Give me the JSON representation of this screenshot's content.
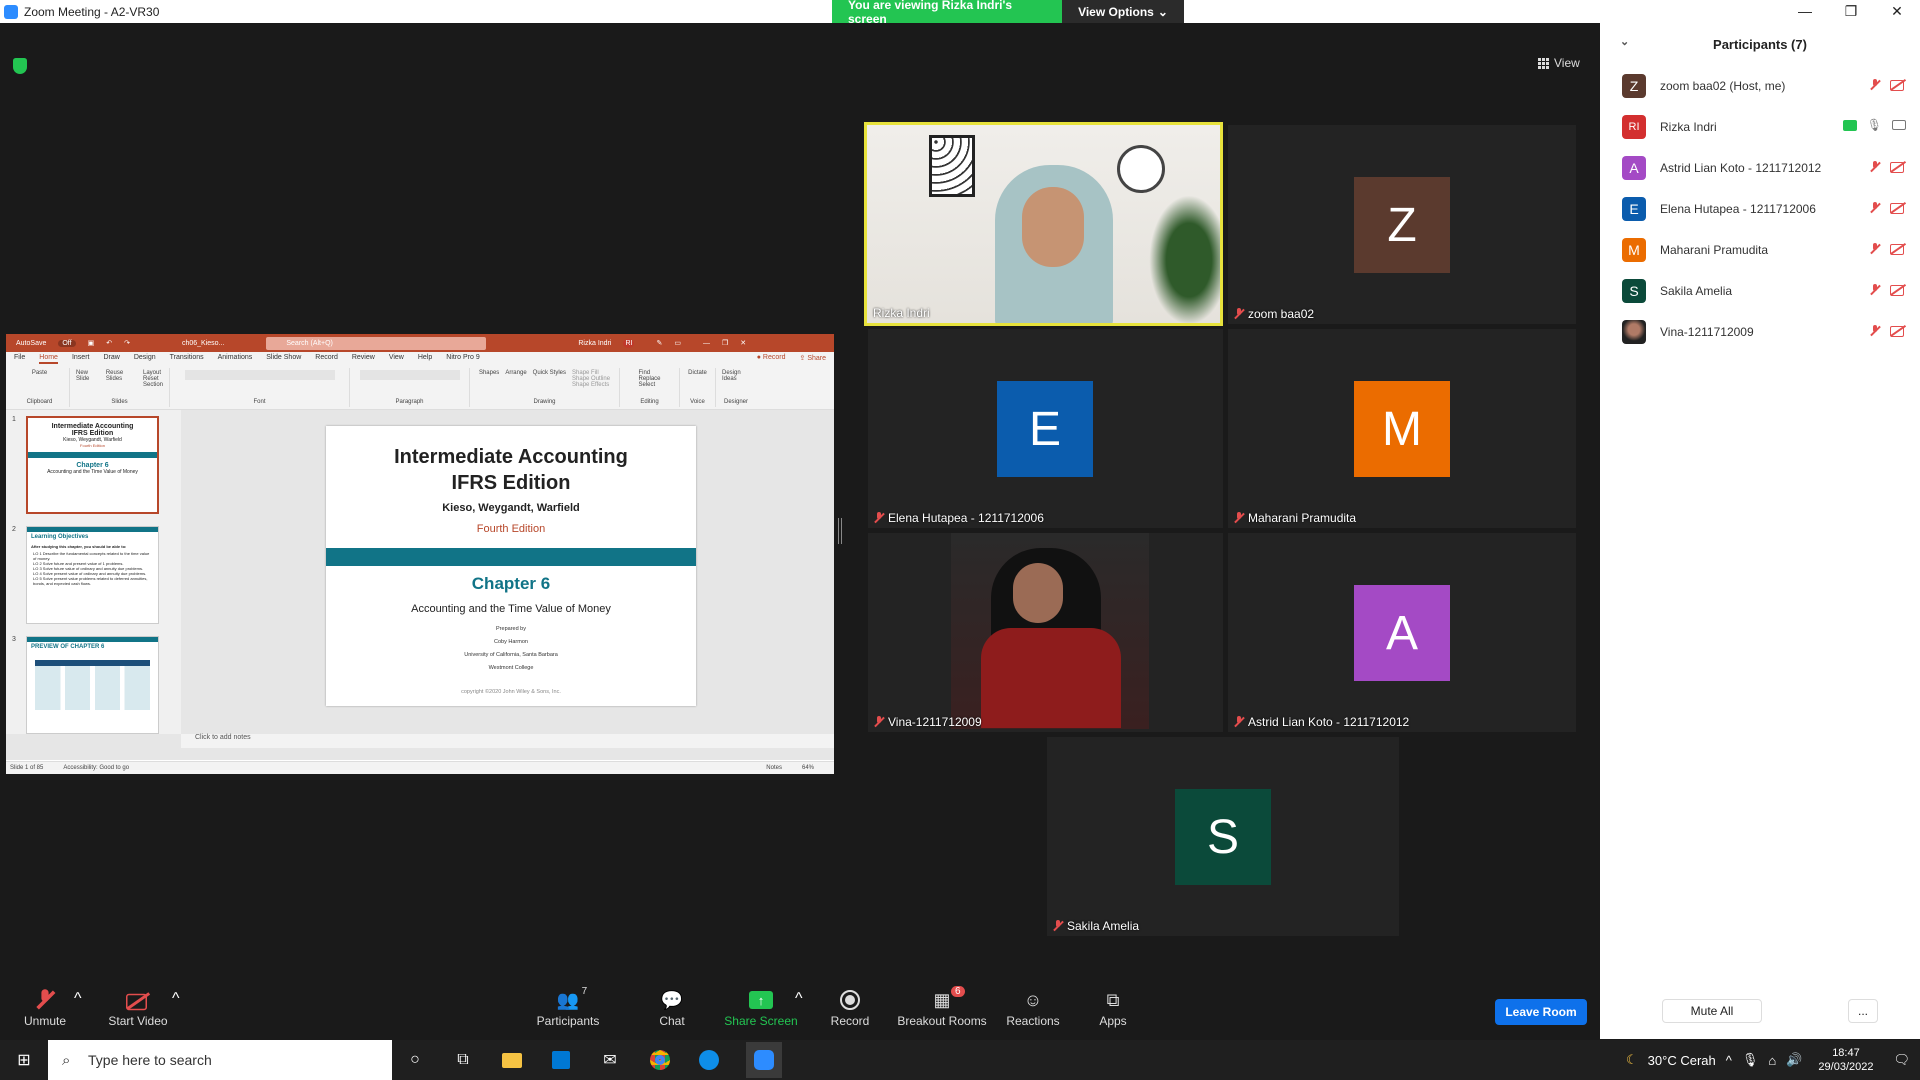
{
  "window": {
    "title": "Zoom Meeting - A2-VR30"
  },
  "share_bar": {
    "viewing": "You are viewing Rizka Indri's screen",
    "options": "View Options"
  },
  "view_button": {
    "label": "View"
  },
  "ppt": {
    "autosave": "AutoSave",
    "autosave_state": "Off",
    "filename": "ch06_Kieso...",
    "search": "Search (Alt+Q)",
    "user": "Rizka Indri",
    "user_initials": "RI",
    "tabs": [
      "File",
      "Home",
      "Insert",
      "Draw",
      "Design",
      "Transitions",
      "Animations",
      "Slide Show",
      "Record",
      "Review",
      "View",
      "Help",
      "Nitro Pro 9"
    ],
    "record": "Record",
    "share": "Share",
    "ribbon_groups": [
      "Clipboard",
      "Slides",
      "Font",
      "Paragraph",
      "Drawing",
      "Editing",
      "Voice",
      "Designer"
    ],
    "ribbon_items": {
      "paste": "Paste",
      "new_slide": "New Slide",
      "reuse": "Reuse Slides",
      "layout": "Layout",
      "reset": "Reset",
      "section": "Section",
      "shapes": "Shapes",
      "arrange": "Arrange",
      "quick": "Quick Styles",
      "shape_fill": "Shape Fill",
      "shape_outline": "Shape Outline",
      "shape_effects": "Shape Effects",
      "find": "Find",
      "replace": "Replace",
      "select": "Select",
      "dictate": "Dictate",
      "design_ideas": "Design Ideas"
    },
    "slide": {
      "title1": "Intermediate Accounting",
      "title2": "IFRS Edition",
      "authors": "Kieso, Weygandt, Warfield",
      "edition": "Fourth Edition",
      "chapter": "Chapter 6",
      "subtitle": "Accounting and the Time Value of Money",
      "prepared": "Prepared by",
      "preparer": "Coby Harmon",
      "univ": "University of California, Santa Barbara",
      "college": "Westmont College",
      "copyright": "copyright ©2020 John Wiley & Sons, Inc."
    },
    "thumbs": [
      {
        "num": "1",
        "title": "Intermediate Accounting",
        "title2": "IFRS Edition",
        "authors": "Kieso, Weygandt, Warfield",
        "edition": "Fourth Edition",
        "chapter": "Chapter 6",
        "subtitle": "Accounting and the Time Value of Money"
      },
      {
        "num": "2",
        "title": "Learning Objectives",
        "intro": "After studying this chapter, you should be able to:",
        "items": [
          "LO 1 Describe the fundamental concepts related to the time value of money.",
          "LO 2 Solve future and present value of 1 problems.",
          "LO 3 Solve future value of ordinary and annuity due problems.",
          "LO 4 Solve present value of ordinary and annuity due problems.",
          "LO 5 Solve present value problems related to deferred annuities, bonds, and expected cash flows."
        ]
      },
      {
        "num": "3",
        "title": "PREVIEW OF CHAPTER 6"
      }
    ],
    "notes": "Click to add notes",
    "status_slide": "Slide 1 of 85",
    "accessibility": "Accessibility: Good to go",
    "notes_btn": "Notes",
    "zoom": "64%"
  },
  "video_tiles": [
    {
      "name": "Rizka Indri",
      "type": "camera",
      "muted": false
    },
    {
      "name": "zoom baa02",
      "type": "avatar",
      "initial": "Z",
      "color": "#5b3a2e",
      "muted": true
    },
    {
      "name": "Elena Hutapea - 1211712006",
      "type": "avatar",
      "initial": "E",
      "color": "#0b5cad",
      "muted": true
    },
    {
      "name": "Maharani Pramudita",
      "type": "avatar",
      "initial": "M",
      "color": "#eb6c00",
      "muted": true
    },
    {
      "name": "Vina-1211712009",
      "type": "camera",
      "muted": true
    },
    {
      "name": "Astrid Lian Koto - 1211712012",
      "type": "avatar",
      "initial": "A",
      "color": "#a44ac5",
      "muted": true
    },
    {
      "name": "Sakila Amelia",
      "type": "avatar",
      "initial": "S",
      "color": "#0b4a3a",
      "muted": true
    }
  ],
  "participants": {
    "title": "Participants (7)",
    "list": [
      {
        "name": "zoom baa02 (Host, me)",
        "initial": "Z",
        "color": "#5b3a2e"
      },
      {
        "name": "Rizka Indri",
        "initial": "RI",
        "color": "#d32f2f"
      },
      {
        "name": "Astrid Lian Koto - 1211712012",
        "initial": "A",
        "color": "#a44ac5"
      },
      {
        "name": "Elena Hutapea - 1211712006",
        "initial": "E",
        "color": "#0b5cad"
      },
      {
        "name": "Maharani Pramudita",
        "initial": "M",
        "color": "#eb6c00"
      },
      {
        "name": "Sakila Amelia",
        "initial": "S",
        "color": "#0b4a3a"
      },
      {
        "name": "Vina-1211712009",
        "initial": "",
        "color": "#6a2a2a"
      }
    ],
    "mute_all": "Mute All",
    "more": "..."
  },
  "toolbar": {
    "unmute": "Unmute",
    "start_video": "Start Video",
    "participants": "Participants",
    "participants_count": "7",
    "chat": "Chat",
    "share_screen": "Share Screen",
    "record": "Record",
    "breakout": "Breakout Rooms",
    "breakout_badge": "6",
    "reactions": "Reactions",
    "apps": "Apps",
    "leave": "Leave Room"
  },
  "taskbar": {
    "search": "Type here to search",
    "weather": "30°C  Cerah",
    "time": "18:47",
    "date": "29/03/2022"
  },
  "colors": {
    "zoom_blue": "#0e71eb",
    "share_green": "#23c552",
    "ppt_red": "#b7472a",
    "teal": "#117487",
    "mute_red": "#e34d4d",
    "speaker_yellow": "#e7e23c"
  }
}
